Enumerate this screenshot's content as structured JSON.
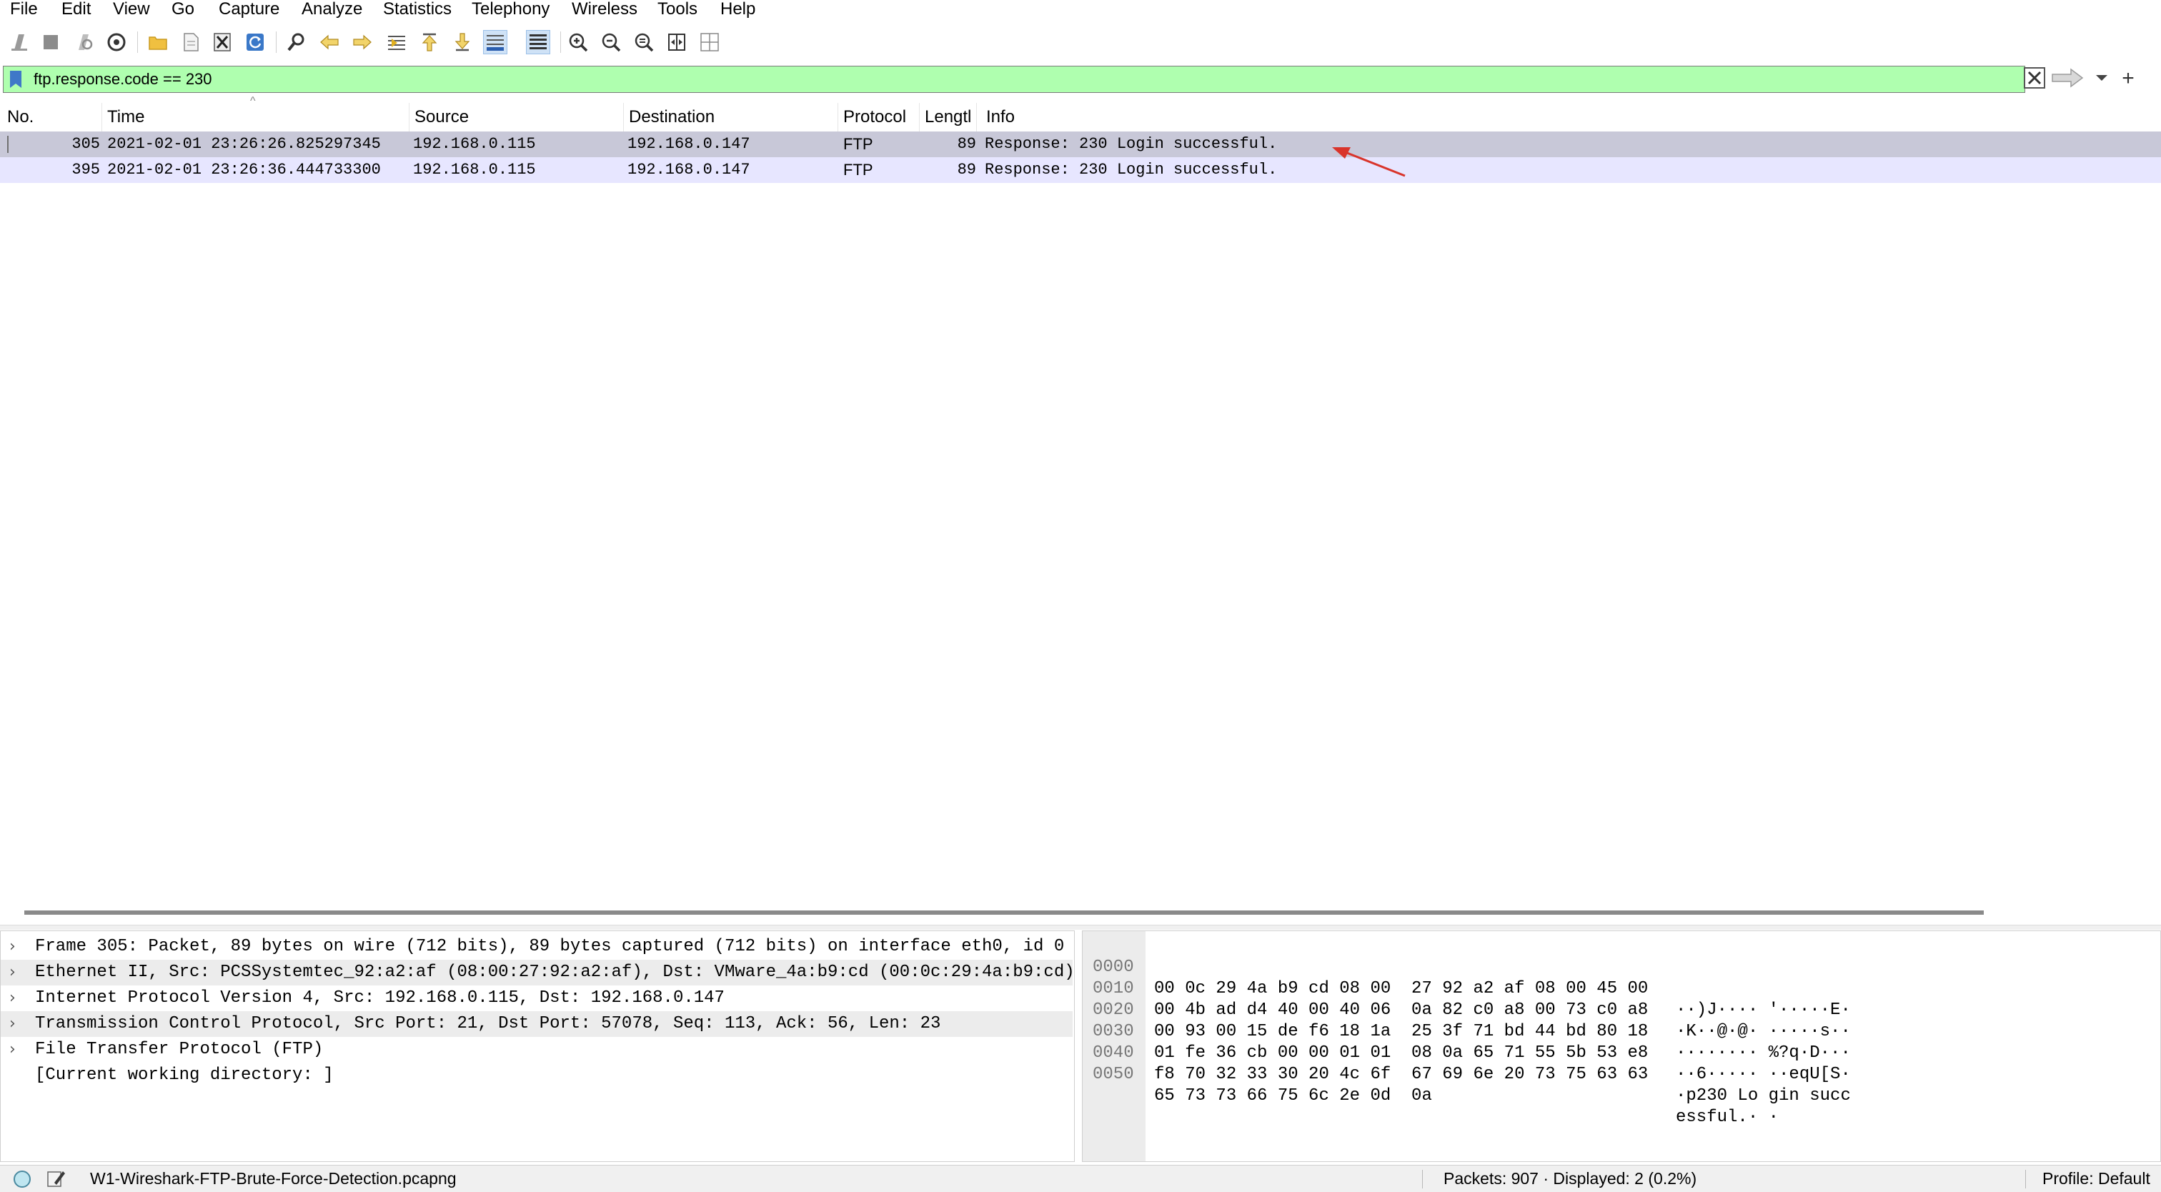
{
  "menu": [
    "File",
    "Edit",
    "View",
    "Go",
    "Capture",
    "Analyze",
    "Statistics",
    "Telephony",
    "Wireless",
    "Tools",
    "Help"
  ],
  "filter": {
    "value": "ftp.response.code == 230"
  },
  "columns": {
    "no": "No.",
    "time": "Time",
    "source": "Source",
    "destination": "Destination",
    "protocol": "Protocol",
    "length": "Lengtl",
    "info": "Info"
  },
  "packets": [
    {
      "no": "305",
      "time": "2021-02-01 23:26:26.825297345",
      "source": "192.168.0.115",
      "destination": "192.168.0.147",
      "protocol": "FTP",
      "length": "89",
      "info": "Response: 230 Login successful."
    },
    {
      "no": "395",
      "time": "2021-02-01 23:26:36.444733300",
      "source": "192.168.0.115",
      "destination": "192.168.0.147",
      "protocol": "FTP",
      "length": "89",
      "info": "Response: 230 Login successful."
    }
  ],
  "details": [
    {
      "text": "Frame 305: Packet, 89 bytes on wire (712 bits), 89 bytes captured (712 bits) on interface eth0, id 0",
      "expander": "›"
    },
    {
      "text": "Ethernet II, Src: PCSSystemtec_92:a2:af (08:00:27:92:a2:af), Dst: VMware_4a:b9:cd (00:0c:29:4a:b9:cd)",
      "expander": "›"
    },
    {
      "text": "Internet Protocol Version 4, Src: 192.168.0.115, Dst: 192.168.0.147",
      "expander": "›"
    },
    {
      "text": "Transmission Control Protocol, Src Port: 21, Dst Port: 57078, Seq: 113, Ack: 56, Len: 23",
      "expander": "›"
    },
    {
      "text": "File Transfer Protocol (FTP)",
      "expander": "›"
    },
    {
      "text": "[Current working directory: ]",
      "expander": ""
    }
  ],
  "bytes": [
    {
      "offset": "0000",
      "hex": "00 0c 29 4a b9 cd 08 00  27 92 a2 af 08 00 45 00",
      "ascii": "··)J···· '·····E·"
    },
    {
      "offset": "0010",
      "hex": "00 4b ad d4 40 00 40 06  0a 82 c0 a8 00 73 c0 a8",
      "ascii": "·K··@·@· ·····s··"
    },
    {
      "offset": "0020",
      "hex": "00 93 00 15 de f6 18 1a  25 3f 71 bd 44 bd 80 18",
      "ascii": "········ %?q·D···"
    },
    {
      "offset": "0030",
      "hex": "01 fe 36 cb 00 00 01 01  08 0a 65 71 55 5b 53 e8",
      "ascii": "··6····· ··eqU[S·"
    },
    {
      "offset": "0040",
      "hex": "f8 70 32 33 30 20 4c 6f  67 69 6e 20 73 75 63 63",
      "ascii": "·p230 Lo gin succ"
    },
    {
      "offset": "0050",
      "hex": "65 73 73 66 75 6c 2e 0d  0a",
      "ascii": "essful.· ·"
    }
  ],
  "status": {
    "file": "W1-Wireshark-FTP-Brute-Force-Detection.pcapng",
    "packets": "Packets: 907 · Displayed: 2 (0.2%)",
    "profile": "Profile: Default"
  },
  "colors": {
    "filter_valid": "#afffaf",
    "selected_row": "#c8c8d8",
    "alt_row": "#e7e6ff",
    "annotation_arrow": "#d9342b"
  }
}
